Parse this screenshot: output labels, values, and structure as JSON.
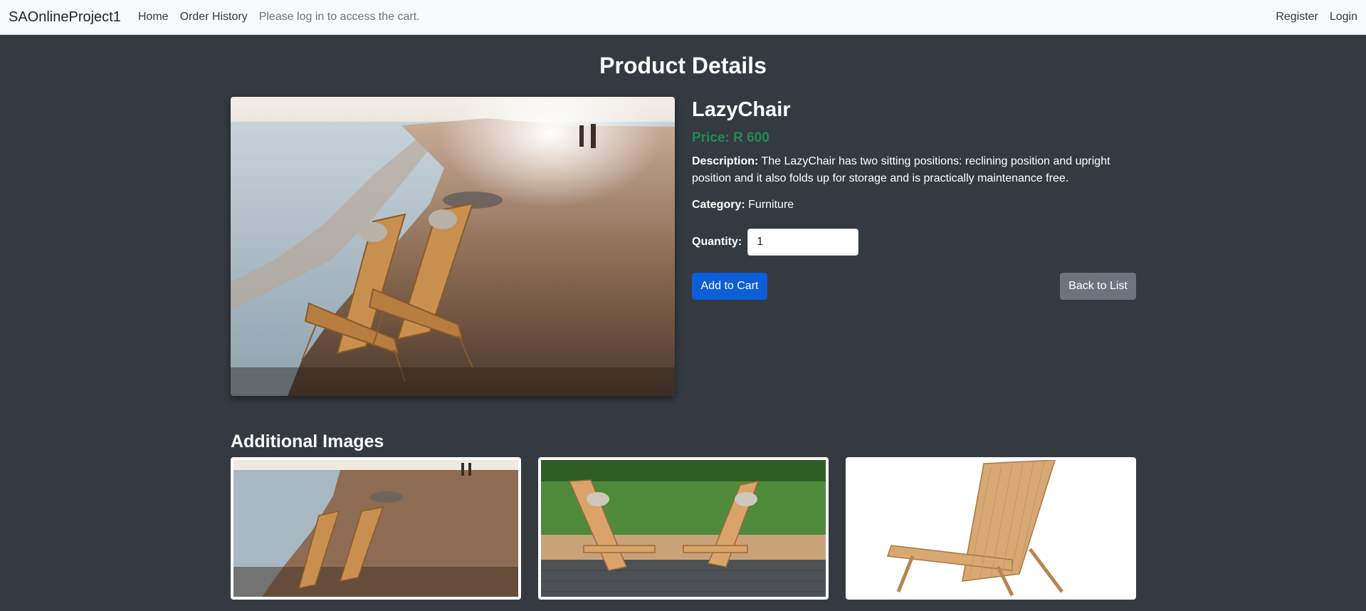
{
  "navbar": {
    "brand": "SAOnlineProject1",
    "links": [
      "Home",
      "Order History"
    ],
    "cart_notice": "Please log in to access the cart.",
    "right_links": [
      "Register",
      "Login"
    ]
  },
  "page": {
    "title": "Product Details"
  },
  "product": {
    "name": "LazyChair",
    "price_label": "Price:",
    "price_value": "R 600",
    "description_label": "Description:",
    "description": "The LazyChair has two sitting positions: reclining position and upright position and it also folds up for storage and is practically maintenance free.",
    "category_label": "Category:",
    "category": "Furniture",
    "quantity_label": "Quantity:",
    "quantity_value": "1"
  },
  "actions": {
    "add_to_cart": "Add to Cart",
    "back_to_list": "Back to List"
  },
  "additional": {
    "title": "Additional Images"
  },
  "colors": {
    "background": "#343a40",
    "navbar": "#f8f9fa",
    "price": "#198754",
    "primary": "#0b5ed7",
    "secondary": "#6c757d"
  }
}
